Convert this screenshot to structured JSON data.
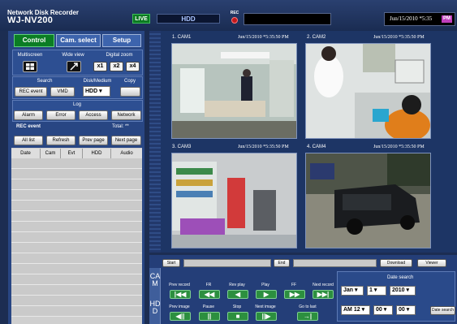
{
  "header": {
    "brand_line1": "Network Disk Recorder",
    "brand_line2": "WJ-NV200",
    "live_badge": "LIVE",
    "mode_display": "HDD",
    "rec_label": "REC",
    "clock": "Jun/15/2010 *5:35",
    "ampm": "PM",
    "colors": {
      "live": "#0c7a22",
      "rec": "#c3191c",
      "pm": "#c03fbd"
    }
  },
  "tabs": [
    {
      "label": "Control",
      "active": true
    },
    {
      "label": "Cam. select",
      "active": false
    },
    {
      "label": "Setup",
      "active": false
    }
  ],
  "view": {
    "multiscreen_label": "Multiscreen",
    "wide_view_label": "Wide view",
    "digital_zoom_label": "Digital zoom",
    "zoom_options": [
      "x1",
      "x2",
      "x4"
    ]
  },
  "search": {
    "search_label": "Search",
    "disk_label": "Disk/Medium",
    "copy_label": "Copy",
    "rec_event_button": "REC event",
    "vmd_button": "VMD",
    "disk_value": "HDD"
  },
  "log": {
    "label": "Log",
    "buttons": [
      "Alarm",
      "Error",
      "Access",
      "Network"
    ]
  },
  "rec_event": {
    "label": "REC event",
    "total": "Total: **",
    "buttons": [
      "All list",
      "Refresh",
      "Prev page",
      "Next page"
    ],
    "columns": [
      "Date",
      "Cam",
      "Evt",
      "HDD",
      "Audio"
    ]
  },
  "cameras": [
    {
      "label": "1. CAM1",
      "timestamp": "Jun/15/2010  *5:35:50 PM"
    },
    {
      "label": "2. CAM2",
      "timestamp": "Jun/15/2010  *5:35:50 PM"
    },
    {
      "label": "3. CAM3",
      "timestamp": "Jun/15/2010  *5:35:50 PM"
    },
    {
      "label": "4. CAM4",
      "timestamp": "Jun/15/2010  *5:35:50 PM"
    }
  ],
  "playback": {
    "start_button": "Start",
    "end_button": "End",
    "download_button": "Download",
    "viewer_button": "Viewer",
    "side_tabs": [
      "CAM",
      "HDD"
    ],
    "row1": [
      {
        "label": "Prev record",
        "icon": "skip-back-icon",
        "glyph": "|◀◀"
      },
      {
        "label": "FR",
        "icon": "fast-reverse-icon",
        "glyph": "◀◀"
      },
      {
        "label": "Rev play",
        "icon": "reverse-play-icon",
        "glyph": "◀"
      },
      {
        "label": "Play",
        "icon": "play-icon",
        "glyph": "▶"
      },
      {
        "label": "FF",
        "icon": "fast-forward-icon",
        "glyph": "▶▶"
      },
      {
        "label": "Next record",
        "icon": "skip-forward-icon",
        "glyph": "▶▶|"
      }
    ],
    "row2": [
      {
        "label": "Prev image",
        "icon": "prev-frame-icon",
        "glyph": "◀||"
      },
      {
        "label": "Pause",
        "icon": "pause-icon",
        "glyph": "||"
      },
      {
        "label": "Stop",
        "icon": "stop-icon",
        "glyph": "■"
      },
      {
        "label": "Next image",
        "icon": "next-frame-icon",
        "glyph": "||▶"
      },
      {
        "label": "Go to last",
        "icon": "go-to-last-icon",
        "glyph": "→|"
      }
    ]
  },
  "date_search": {
    "label": "Date search",
    "month": "Jan",
    "day": "1",
    "year": "2010",
    "hour": "AM 12",
    "minute": "00",
    "second": "00",
    "button": "Date search"
  }
}
